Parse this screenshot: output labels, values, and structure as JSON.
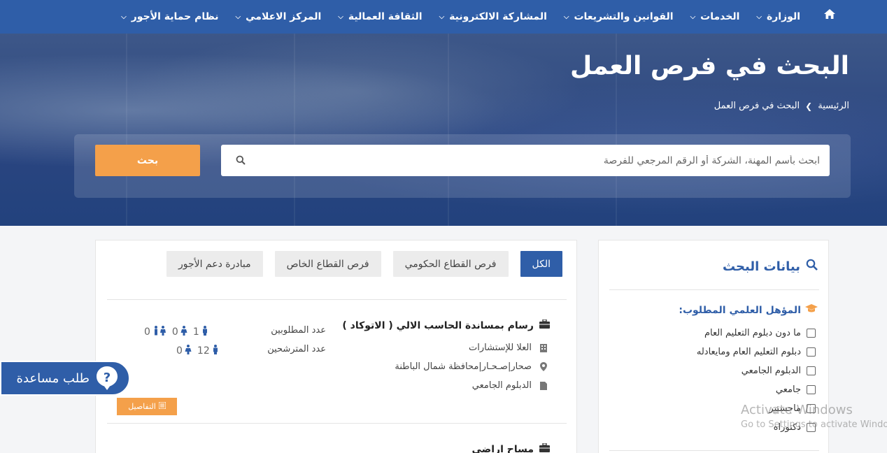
{
  "nav": {
    "items": [
      {
        "label": "الوزارة"
      },
      {
        "label": "الخدمات"
      },
      {
        "label": "القوانين والتشريعات"
      },
      {
        "label": "المشاركة الالكترونية"
      },
      {
        "label": "الثقافة العمالية"
      },
      {
        "label": "المركز الاعلامي"
      },
      {
        "label": "نظام حماية الأجور"
      }
    ],
    "bg_color": "#2f5ea8"
  },
  "hero": {
    "title": "البحث في فرص العمل",
    "breadcrumb": {
      "home": "الرئيسية",
      "current": "البحث في فرص العمل"
    },
    "search": {
      "placeholder": "ابحث بأسم المهنة، الشركة أو الرقم المرجعي للفرصة",
      "button": "بحث"
    }
  },
  "tabs": [
    {
      "label": "الكل",
      "active": true
    },
    {
      "label": "فرص القطاع الحكومي",
      "active": false
    },
    {
      "label": "فرص القطاع الخاص",
      "active": false
    },
    {
      "label": "مبادرة دعم الأجور",
      "active": false
    }
  ],
  "jobs": [
    {
      "title": "رسام بمساندة الحاسب الالي ( الاتوكاد )",
      "company": "العلا للإستشارات",
      "location": "صحار|صـحـار|محافظة شمال الباطنة",
      "qualification": "الدبلوم الجامعي",
      "required_label": "عدد المطلوبين",
      "applicants_label": "عدد المترشحين",
      "required_counts": {
        "male": "1",
        "female": "0",
        "any": "0"
      },
      "applicant_counts": {
        "male": "12",
        "female": "0"
      },
      "details_button": "التفاصيل"
    },
    {
      "title": "مساح اراضي"
    }
  ],
  "sidebar": {
    "title": "بيانات البحث",
    "filter_heading": "المؤهل العلمي المطلوب:",
    "options": [
      {
        "label": "ما دون دبلوم التعليم العام"
      },
      {
        "label": "دبلوم التعليم العام ومايعادله"
      },
      {
        "label": "الدبلوم الجامعي"
      },
      {
        "label": "جامعي"
      },
      {
        "label": "ماجستير"
      },
      {
        "label": "دكتوراه"
      }
    ]
  },
  "help": {
    "label": "طلب مساعدة"
  },
  "watermark": {
    "line1": "Activate Windows",
    "line2": "Go to Settings to activate Windows."
  },
  "colors": {
    "primary": "#2f5ea8",
    "accent": "#f4a04a"
  }
}
